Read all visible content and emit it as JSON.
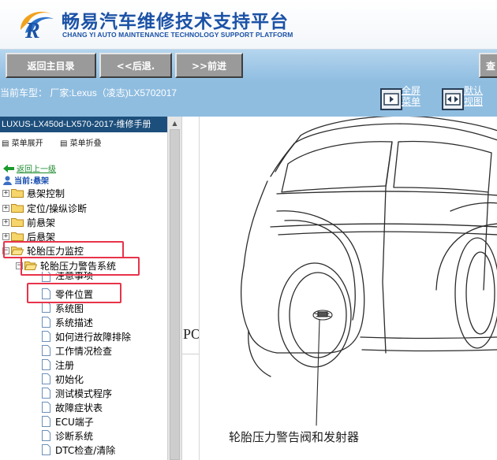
{
  "header": {
    "title": "畅易汽车维修技术支持平台",
    "subtitle": "CHANG YI AUTO MAINTENANCE TECHNOLOGY SUPPORT PLATFORM"
  },
  "nav": {
    "home": "返回主目录",
    "back": "<<后退.",
    "forward": ">>前进",
    "search_partial": "查"
  },
  "info": {
    "model": "当前车型： 厂家:Lexus（凌志)LX5702017",
    "fullscreen": "全屏\n菜单",
    "default_view": "默认\n视图"
  },
  "sidebar": {
    "manual_title": "LUXUS-LX450d-LX570-2017-维修手册",
    "expand_menu": "菜单展开",
    "collapse_menu": "菜单折叠",
    "back_up": "返回上一级",
    "current": "当前:悬架",
    "tree": [
      {
        "label": "悬架控制"
      },
      {
        "label": "定位/操纵诊断"
      },
      {
        "label": "前悬架"
      },
      {
        "label": "后悬架"
      },
      {
        "label": "轮胎压力监控"
      },
      {
        "label": "轮胎压力警告系统"
      },
      {
        "label": "注意事项"
      },
      {
        "label": "零件位置"
      },
      {
        "label": "系统图"
      },
      {
        "label": "系统描述"
      },
      {
        "label": "如何进行故障排除"
      },
      {
        "label": "工作情况检查"
      },
      {
        "label": "注册"
      },
      {
        "label": "初始化"
      },
      {
        "label": "测试模式程序"
      },
      {
        "label": "故障症状表"
      },
      {
        "label": "ECU端子"
      },
      {
        "label": "诊断系统"
      },
      {
        "label": "DTC检查/清除"
      }
    ]
  },
  "content": {
    "divider_text": "PO",
    "caption": "轮胎压力警告阀和发射器"
  },
  "colors": {
    "brand_blue": "#1b52a6",
    "nav_bg": "#a9cfea",
    "manual_title_bg": "#1d4f7c",
    "highlight_red": "#e8334a"
  }
}
